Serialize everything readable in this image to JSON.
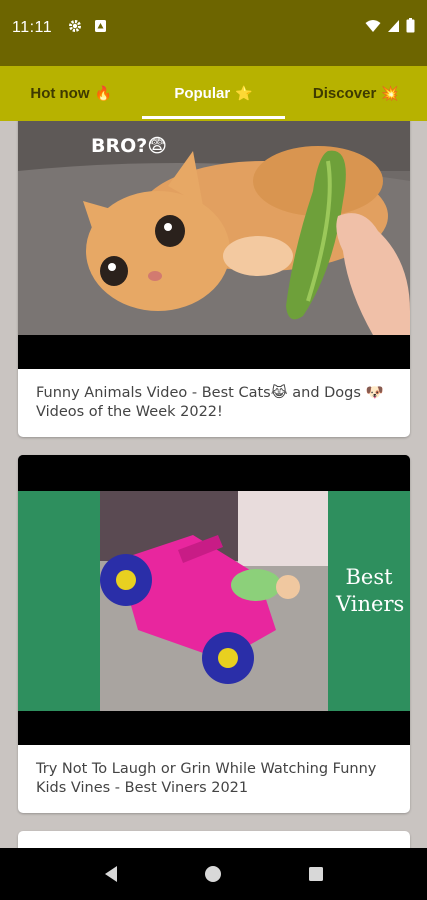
{
  "status_bar": {
    "time": "11:11",
    "icons_left": [
      "gear-icon",
      "android-icon"
    ],
    "icons_right": [
      "wifi-icon",
      "signal-icon",
      "battery-icon"
    ],
    "background": "#6d6500"
  },
  "tabs": {
    "background": "#b7b200",
    "items": [
      {
        "label": "Hot now",
        "emoji": "🔥",
        "active": false
      },
      {
        "label": "Popular",
        "emoji": "⭐",
        "active": true
      },
      {
        "label": "Discover",
        "emoji": "💥",
        "active": false
      }
    ]
  },
  "feed": {
    "cards": [
      {
        "overlay_text": "BRO?😨",
        "title": "Funny Animals Video - Best Cats😹 and Dogs 🐶 Videos of the Week 2022!"
      },
      {
        "overlay_text": "Best Viners",
        "title": "Try Not To Laugh or Grin While Watching Funny Kids Vines - Best Viners 2021"
      }
    ]
  },
  "nav_bar": {
    "buttons": [
      "back-icon",
      "home-icon",
      "recents-icon"
    ]
  }
}
